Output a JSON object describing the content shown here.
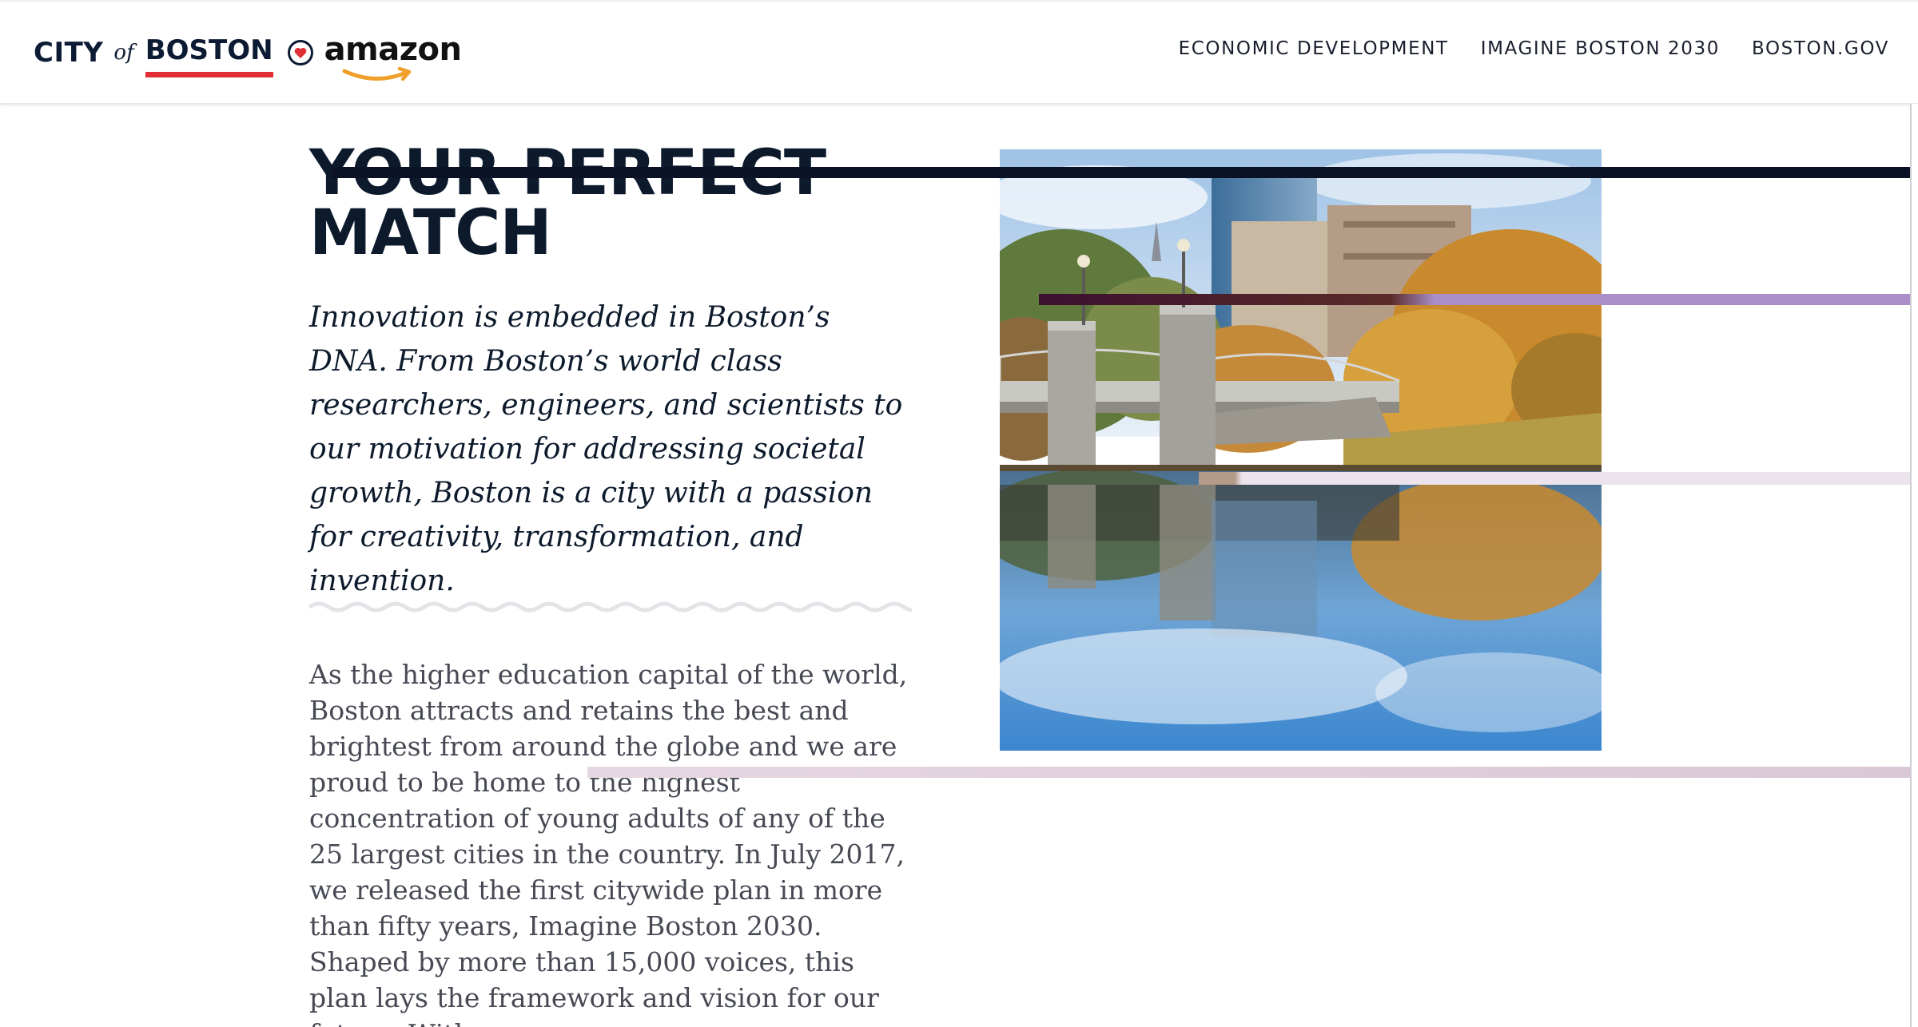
{
  "header": {
    "logo": {
      "city": "CITY",
      "of": "of",
      "boston": "BOSTON",
      "heart_icon": "heart-icon",
      "partner": "amazon",
      "partner_smile_icon": "amazon-smile-icon"
    },
    "nav": [
      {
        "label": "ECONOMIC DEVELOPMENT"
      },
      {
        "label": "IMAGINE BOSTON 2030"
      },
      {
        "label": "BOSTON.GOV"
      }
    ]
  },
  "main": {
    "headline_line1": "YOUR PERFECT",
    "headline_line2": "MATCH",
    "intro": "Innovation is embedded in Boston’s DNA. From Boston’s world class researchers, engineers, and scientists to our motivation for addressing societal growth, Boston is a city with a passion for creativity, transformation, and invention.",
    "body": "As the higher education capital of the world, Boston attracts and retains the best and brightest from around the globe and we are proud to be home to the highest concentration of young adults of any of the 25 largest cities in the country. In July 2017, we released the first citywide plan in more than fifty years, Imagine Boston 2030. Shaped by more than 15,000 voices, this plan lays the framework and vision for our future. With"
  },
  "photo": {
    "subject": "public-garden-bridge-photo"
  },
  "colors": {
    "navy": "#0c1a2c",
    "brand_red": "#e02e34",
    "amazon_orange": "#f0a02a",
    "body_gray": "#474a55"
  }
}
